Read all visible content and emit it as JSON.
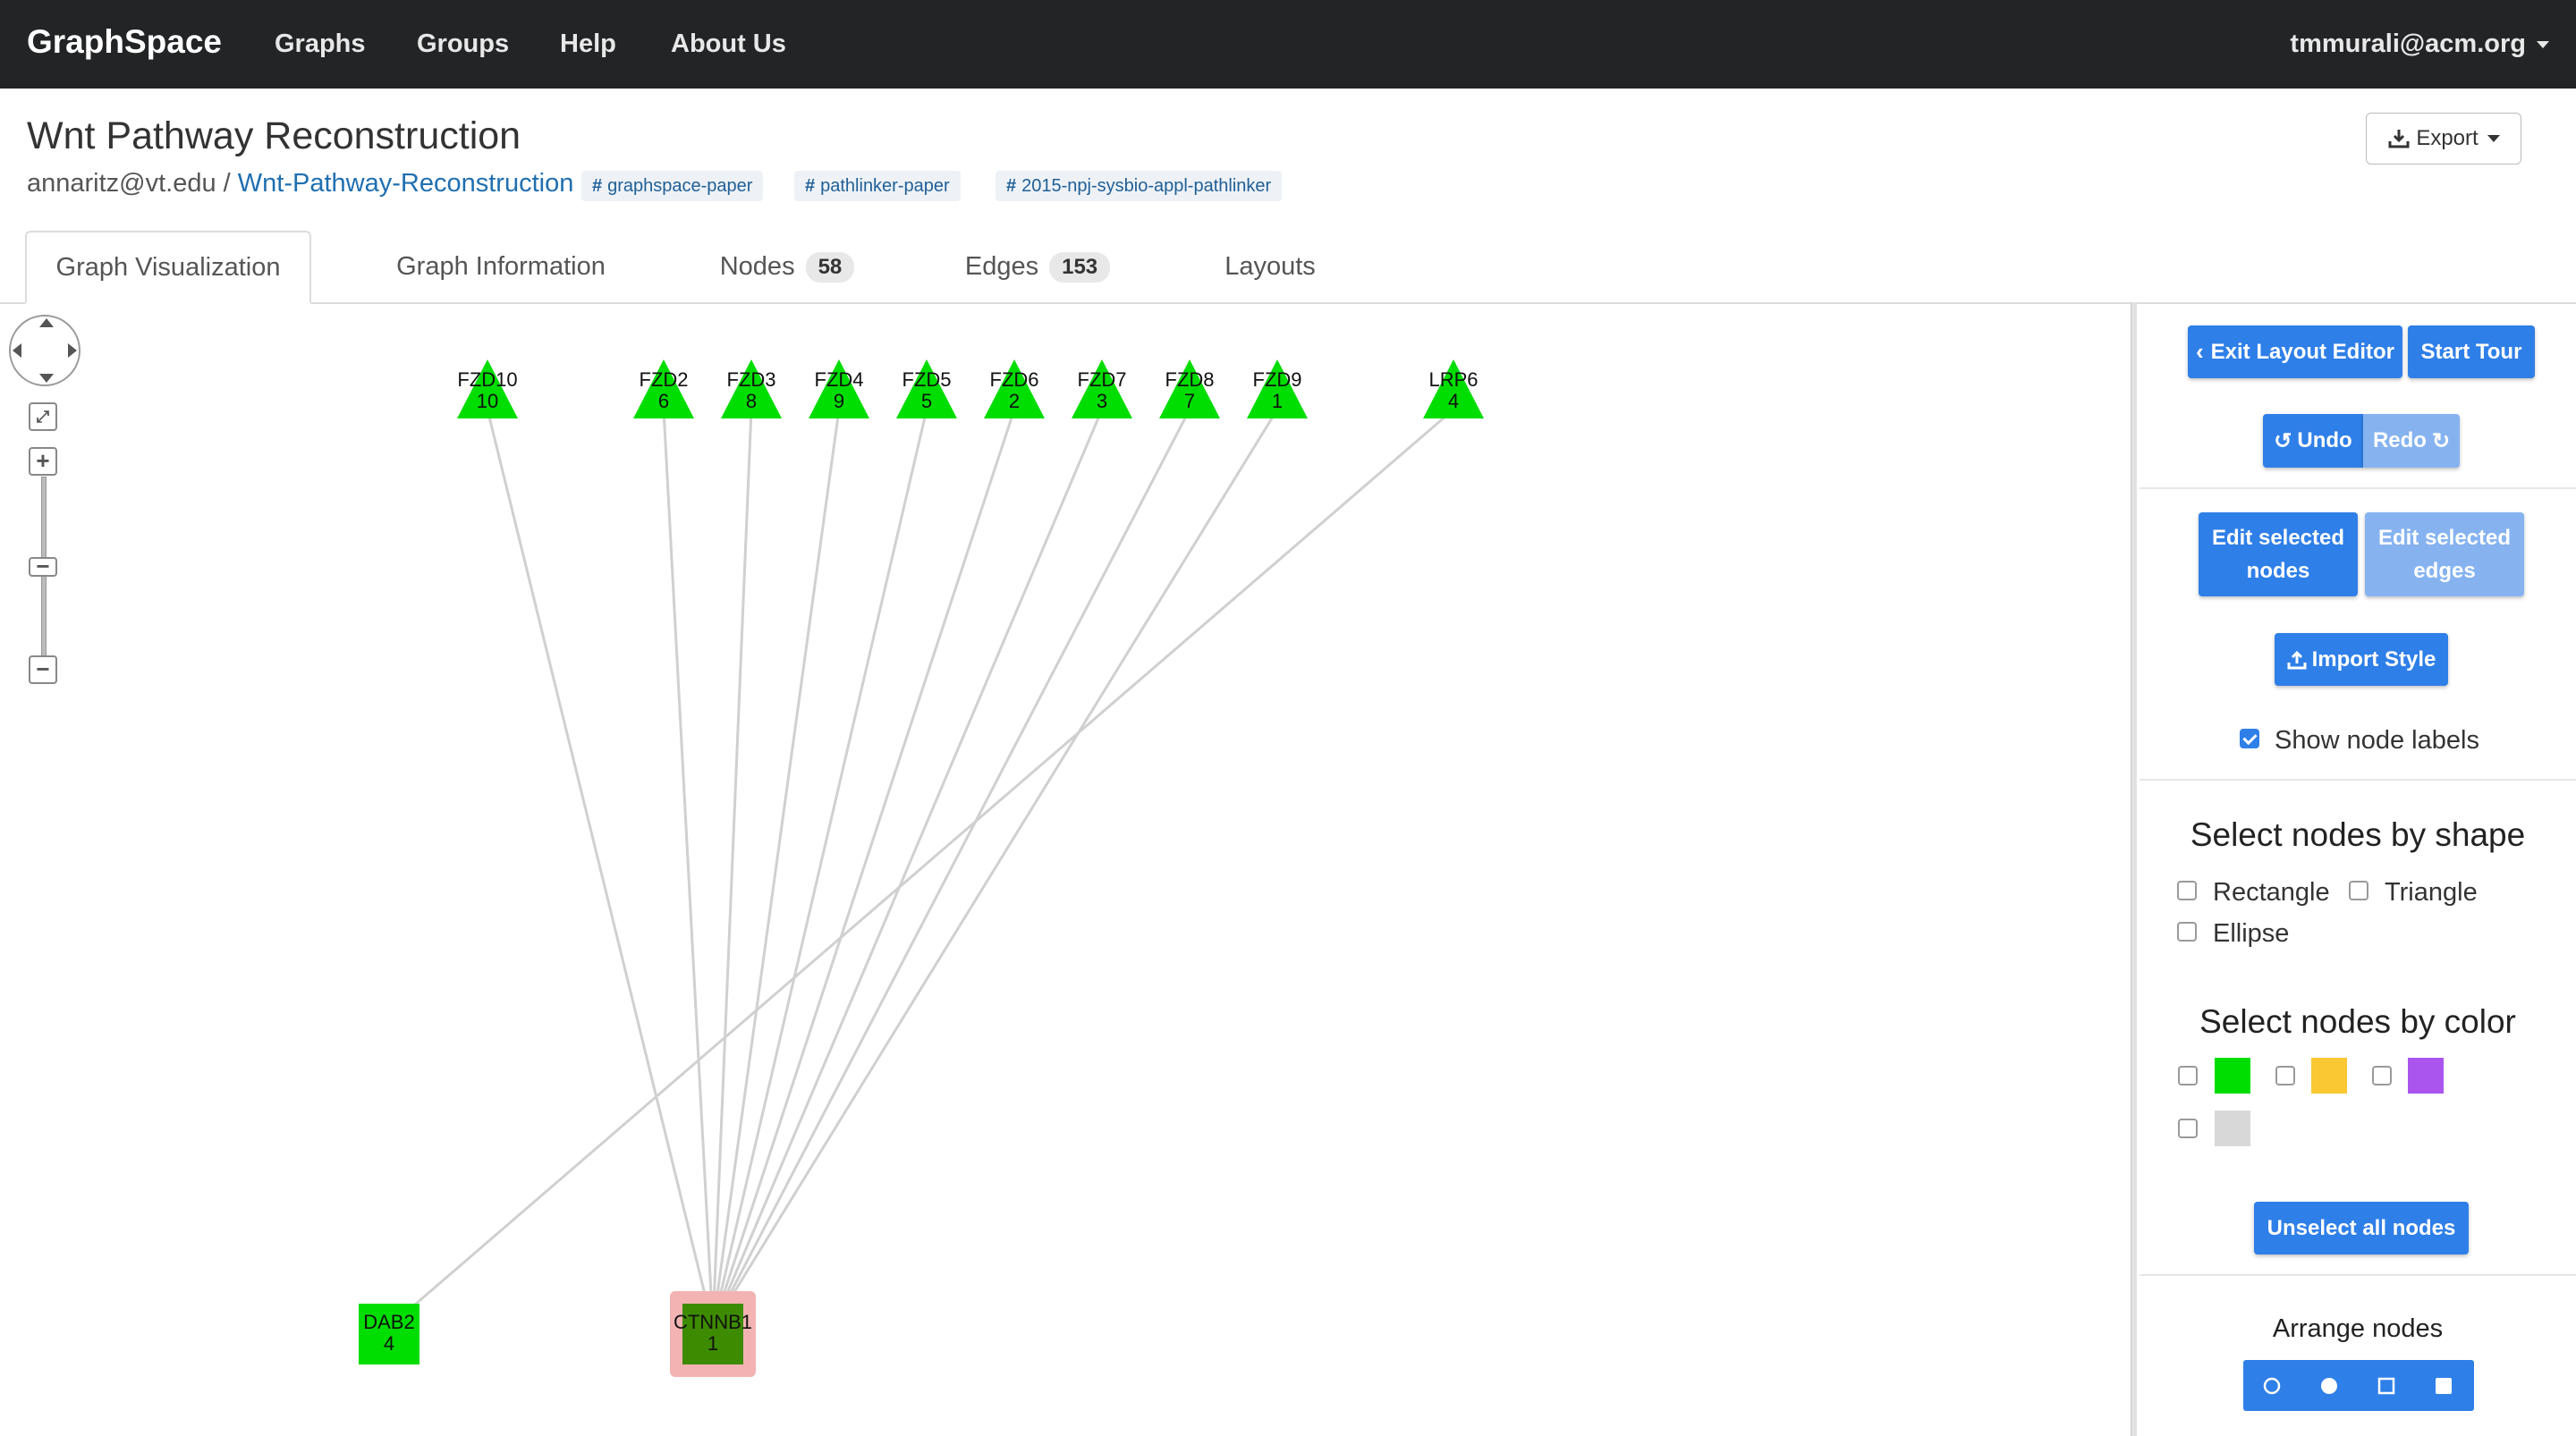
{
  "navbar": {
    "brand": "GraphSpace",
    "items": [
      "Graphs",
      "Groups",
      "Help",
      "About Us"
    ],
    "user": "tmmurali@acm.org"
  },
  "header": {
    "title": "Wnt Pathway Reconstruction",
    "owner": "annaritz@vt.edu",
    "separator": "/",
    "graph_link": "Wnt-Pathway-Reconstruction",
    "tags": [
      "graphspace-paper",
      "pathlinker-paper",
      "2015-npj-sysbio-appl-pathlinker"
    ],
    "export_label": "Export"
  },
  "tabs": [
    {
      "label": "Graph Visualization"
    },
    {
      "label": "Graph Information"
    },
    {
      "label": "Nodes",
      "count": "58"
    },
    {
      "label": "Edges",
      "count": "153"
    },
    {
      "label": "Layouts"
    }
  ],
  "graph": {
    "colors": {
      "node_green": "#00dd00",
      "selected_node_fill": "#3d8b00",
      "selected_highlight": "#f4b3b3",
      "edge": "#d0d0d0"
    },
    "nodes": [
      {
        "id": "FZD10",
        "value": "10",
        "shape": "triangle"
      },
      {
        "id": "FZD2",
        "value": "6",
        "shape": "triangle"
      },
      {
        "id": "FZD3",
        "value": "8",
        "shape": "triangle"
      },
      {
        "id": "FZD4",
        "value": "9",
        "shape": "triangle"
      },
      {
        "id": "FZD5",
        "value": "5",
        "shape": "triangle"
      },
      {
        "id": "FZD6",
        "value": "2",
        "shape": "triangle"
      },
      {
        "id": "FZD7",
        "value": "3",
        "shape": "triangle"
      },
      {
        "id": "FZD8",
        "value": "7",
        "shape": "triangle"
      },
      {
        "id": "FZD9",
        "value": "1",
        "shape": "triangle"
      },
      {
        "id": "LRP6",
        "value": "4",
        "shape": "triangle"
      },
      {
        "id": "DAB2",
        "value": "4",
        "shape": "rectangle"
      },
      {
        "id": "CTNNB1",
        "value": "1",
        "shape": "rectangle",
        "selected": true
      }
    ],
    "edges": [
      [
        "FZD10",
        "CTNNB1"
      ],
      [
        "FZD2",
        "CTNNB1"
      ],
      [
        "FZD3",
        "CTNNB1"
      ],
      [
        "FZD4",
        "CTNNB1"
      ],
      [
        "FZD5",
        "CTNNB1"
      ],
      [
        "FZD6",
        "CTNNB1"
      ],
      [
        "FZD7",
        "CTNNB1"
      ],
      [
        "FZD8",
        "CTNNB1"
      ],
      [
        "FZD9",
        "CTNNB1"
      ],
      [
        "LRP6",
        "DAB2"
      ]
    ]
  },
  "panel": {
    "exit_layout_editor": "Exit Layout Editor",
    "start_tour": "Start Tour",
    "undo": "Undo",
    "redo": "Redo",
    "edit_nodes_line1": "Edit selected",
    "edit_nodes_line2": "nodes",
    "edit_edges_line1": "Edit selected",
    "edit_edges_line2": "edges",
    "import_style": "Import Style",
    "show_node_labels": "Show node labels",
    "show_node_labels_checked": true,
    "select_by_shape_heading": "Select nodes by shape",
    "shapes": [
      "Rectangle",
      "Triangle",
      "Ellipse"
    ],
    "select_by_color_heading": "Select nodes by color",
    "color_swatches": [
      "#00dd00",
      "#fac832",
      "#aa55ee",
      "#d8d8d8"
    ],
    "unselect_all": "Unselect all nodes",
    "arrange_heading": "Arrange nodes",
    "arrange_icons": [
      "circle-outline-icon",
      "circle-filled-icon",
      "square-outline-icon",
      "square-filled-icon"
    ]
  }
}
